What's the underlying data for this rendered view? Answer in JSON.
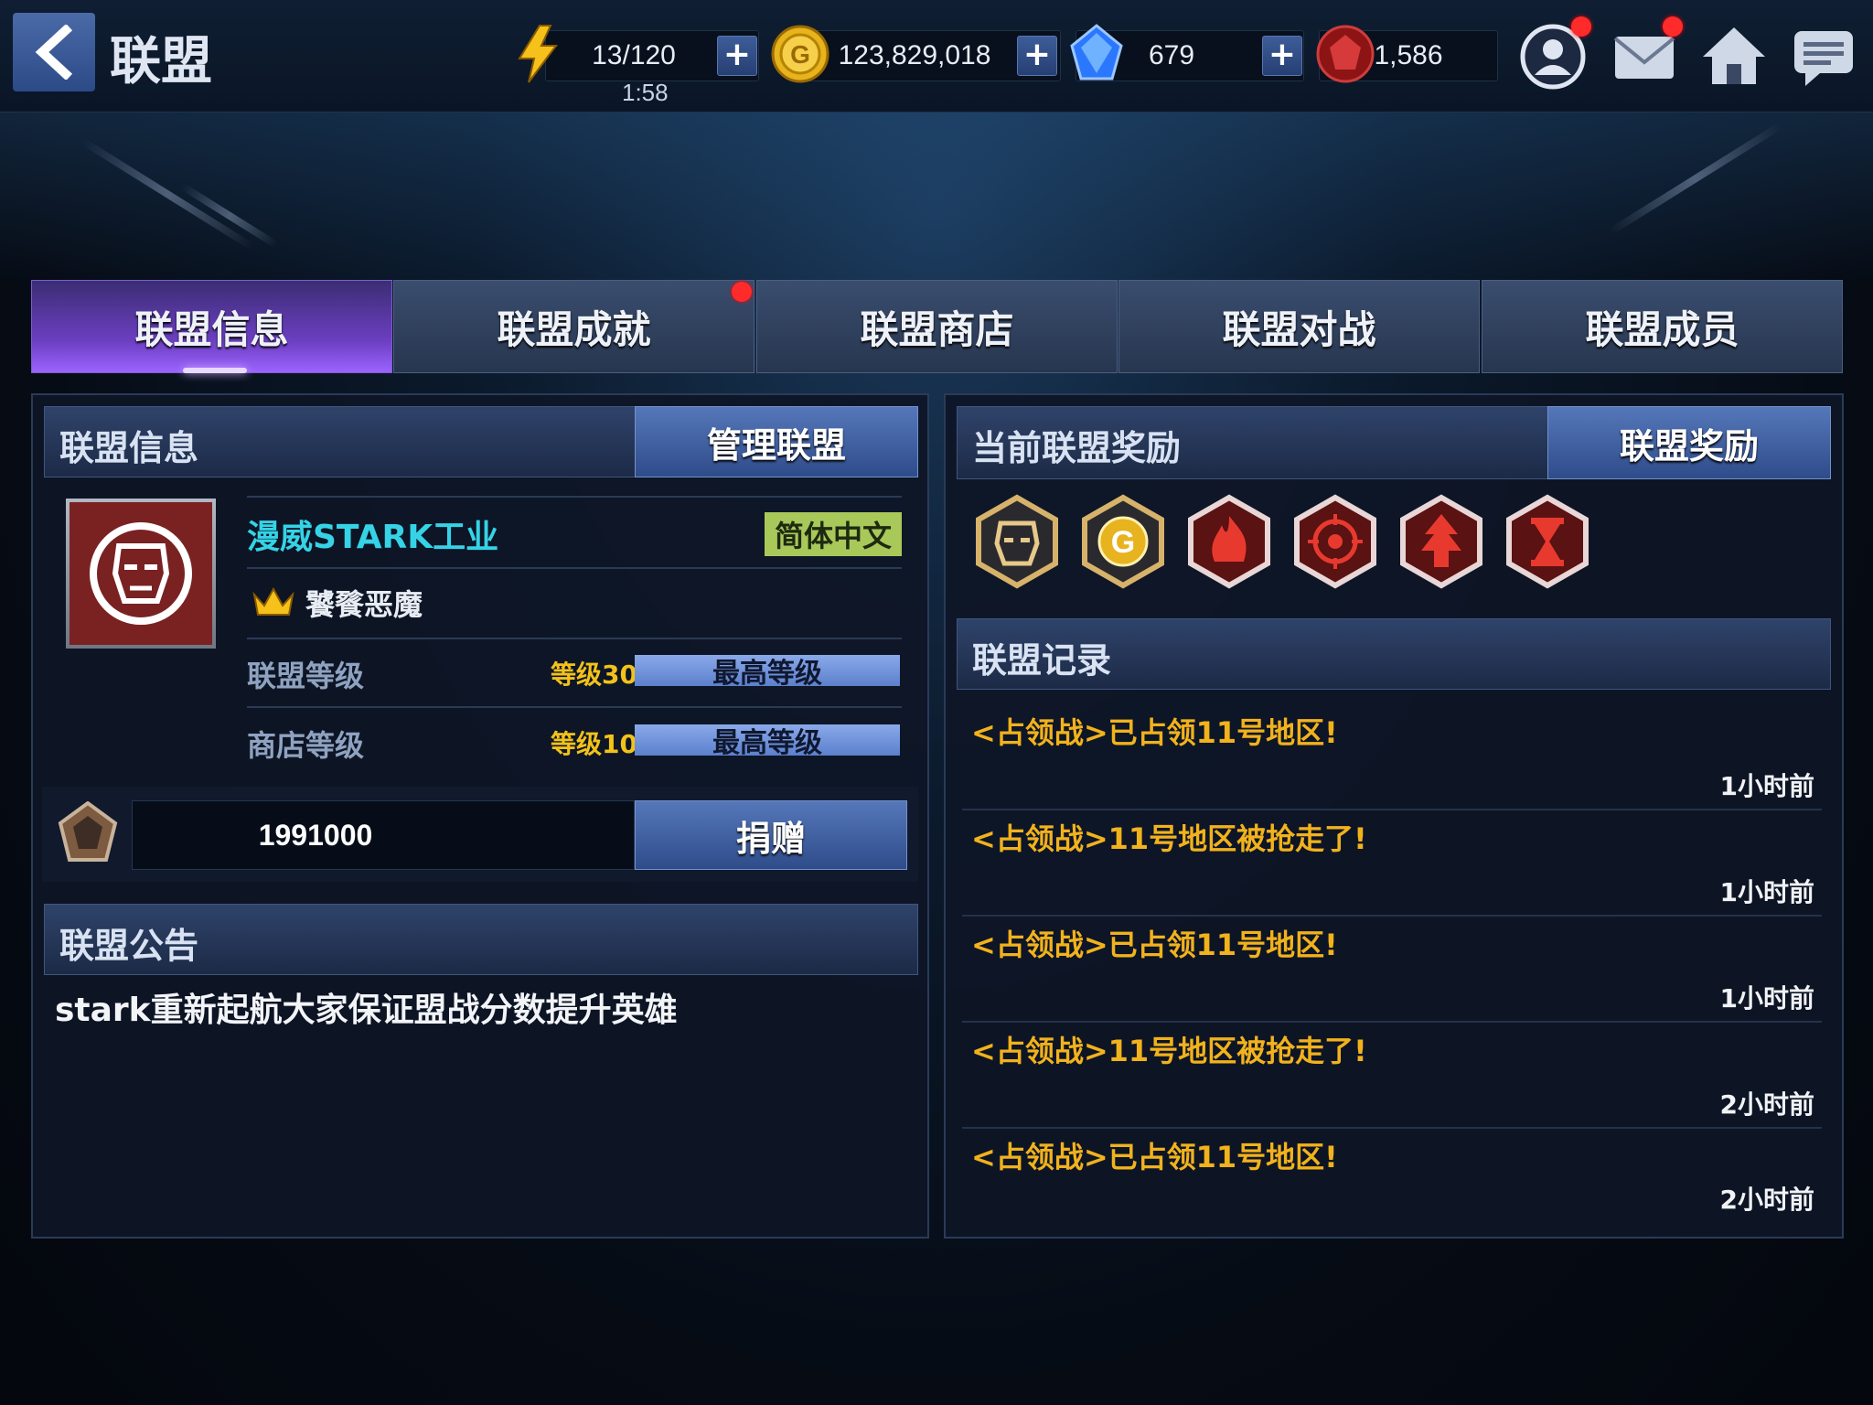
{
  "header": {
    "title": "联盟",
    "energy": "13/120",
    "energy_timer": "1:58",
    "gold": "123,829,018",
    "crystals": "679",
    "red_currency": "1,586"
  },
  "tabs": [
    {
      "label": "联盟信息"
    },
    {
      "label": "联盟成就"
    },
    {
      "label": "联盟商店"
    },
    {
      "label": "联盟对战"
    },
    {
      "label": "联盟成员"
    }
  ],
  "info": {
    "section_title": "联盟信息",
    "manage_button": "管理联盟",
    "alliance_name": "漫威STARK工业",
    "language": "简体中文",
    "leader": "饕餮恶魔",
    "alliance_level_label": "联盟等级",
    "alliance_level_value": "等级30",
    "alliance_level_status": "最高等级",
    "shop_level_label": "商店等级",
    "shop_level_value": "等级10",
    "shop_level_status": "最高等级",
    "donation_amount": "1991000",
    "donate_button": "捐赠"
  },
  "notice": {
    "section_title": "联盟公告",
    "text": "stark重新起航大家保证盟战分数提升英雄"
  },
  "rewards": {
    "section_title": "当前联盟奖励",
    "button": "联盟奖励",
    "icons": [
      "iron-man-reward-icon",
      "gold-reward-icon",
      "fire-reward-icon",
      "target-reward-icon",
      "tree-reward-icon",
      "hourglass-reward-icon"
    ]
  },
  "log": {
    "section_title": "联盟记录",
    "entries": [
      {
        "text": "<占领战>已占领11号地区!",
        "time": "1小时前"
      },
      {
        "text": "<占领战>11号地区被抢走了!",
        "time": "1小时前"
      },
      {
        "text": "<占领战>已占领11号地区!",
        "time": "1小时前"
      },
      {
        "text": "<占领战>11号地区被抢走了!",
        "time": "2小时前"
      },
      {
        "text": "<占领战>已占领11号地区!",
        "time": "2小时前"
      }
    ]
  },
  "colors": {
    "accent_purple": "#6b3ec0",
    "log_text": "#f2b21c",
    "alliance_name": "#35d3e6",
    "level_text": "#f2c21a"
  }
}
